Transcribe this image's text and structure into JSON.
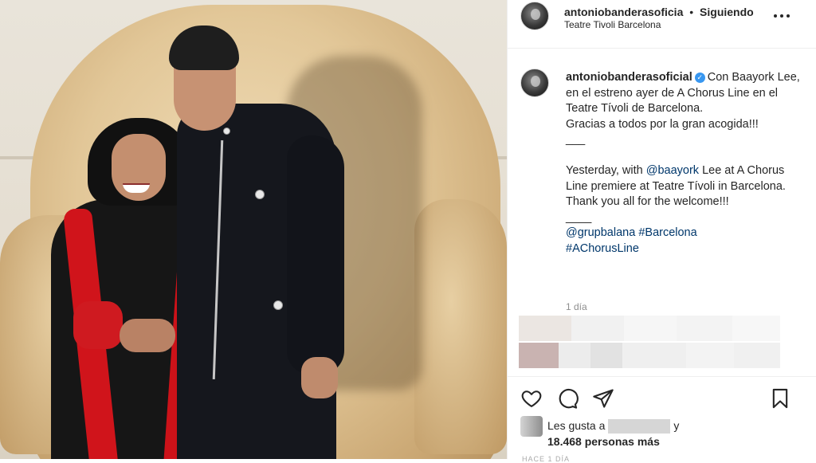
{
  "post": {
    "username": "antoniobanderasoficial",
    "header_username": "antoniobanderasoficia",
    "dot": "•",
    "follow_status": "Siguiendo",
    "location": "Teatre Tivoli Barcelona"
  },
  "caption": {
    "intro": "Con Baayork Lee, en el estreno ayer de A Chorus Line en el Teatre Tívoli de Barcelona.",
    "thanks": "Gracias a todos por la gran acogida!!!",
    "sep1": "___",
    "en_prefix": "Yesterday, with ",
    "mention_baayork": "@baayork",
    "en_suffix": " Lee at A Chorus Line premiere at Teatre Tívoli in Barcelona. Thank you all for the welcome!!!",
    "sep2": "____",
    "mention_grupbalana": "@grupbalana",
    "tag_barcelona": "#Barcelona",
    "tag_achorusline": "#AChorusLine",
    "time_ago": "1 día"
  },
  "likes": {
    "prefix": "Les gusta a",
    "and": "y",
    "count_text": "18.468 personas más"
  },
  "footer": {
    "cut_text": "HACE 1 DÍA"
  },
  "icons": [
    "more-icon",
    "verified-icon",
    "heart-icon",
    "comment-icon",
    "share-icon",
    "bookmark-icon"
  ],
  "colors": {
    "link": "#00376b",
    "verified": "#3897f0",
    "muted": "#8e8e8e",
    "text": "#262626"
  }
}
